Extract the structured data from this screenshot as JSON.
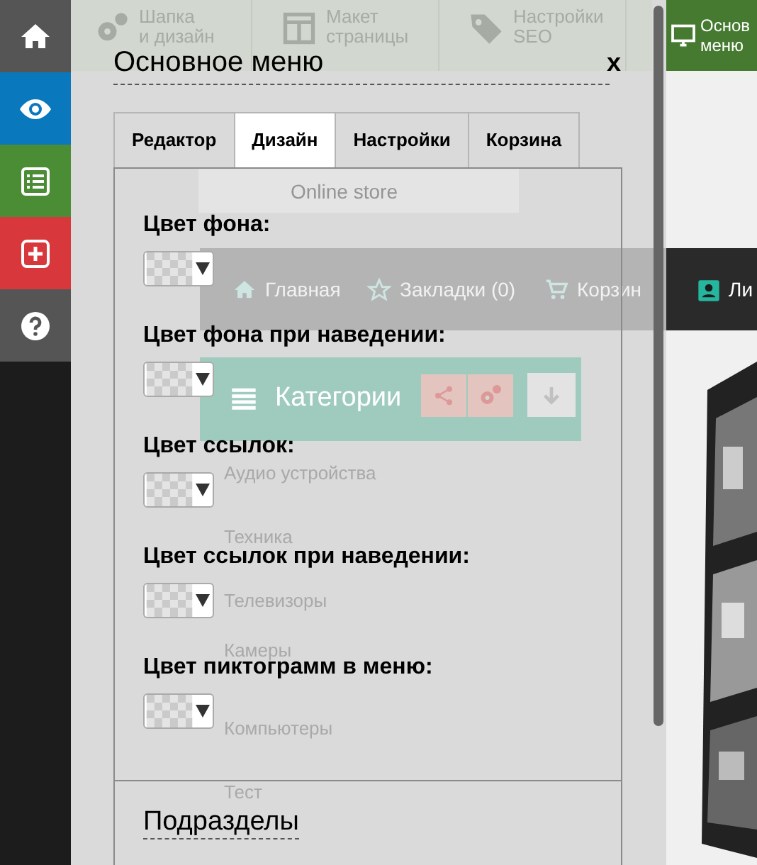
{
  "sidebar": [
    {
      "kind": "home",
      "color": "#555555"
    },
    {
      "kind": "eye",
      "color": "#0a78bd"
    },
    {
      "kind": "list",
      "color": "#4b8d35"
    },
    {
      "kind": "plus",
      "color": "#d8383b"
    },
    {
      "kind": "help",
      "color": "#555555"
    }
  ],
  "background_page": {
    "toolbar": [
      {
        "kind": "gears",
        "label": "Шапка\nи дизайн"
      },
      {
        "kind": "layout",
        "label": "Макет\nстраницы"
      },
      {
        "kind": "tag",
        "label": "Настройки\nSEO"
      }
    ],
    "main_menu_button": "Основ\nменю",
    "logo_tagline": "Online store",
    "nav": [
      {
        "kind": "home",
        "label": "Главная"
      },
      {
        "kind": "star",
        "label": "Закладки (0)"
      },
      {
        "kind": "cart",
        "label": "Корзин"
      }
    ],
    "account_label": "Ли",
    "categories": {
      "title": "Категории",
      "items": [
        "Аудио устройства",
        "Техника",
        "Телевизоры",
        "Камеры",
        "Компьютеры",
        "Тест"
      ]
    }
  },
  "panel": {
    "title": "Основное меню",
    "close": "x",
    "tabs": [
      {
        "label": "Редактор",
        "selected": false
      },
      {
        "label": "Дизайн",
        "selected": true
      },
      {
        "label": "Настройки",
        "selected": false
      },
      {
        "label": "Корзина",
        "selected": false
      }
    ],
    "fields": [
      {
        "label": "Цвет фона:"
      },
      {
        "label": "Цвет фона при наведении:"
      },
      {
        "label": "Цвет ссылок:"
      },
      {
        "label": "Цвет ссылок при наведении:"
      },
      {
        "label": "Цвет пиктограмм в меню:"
      }
    ],
    "section": "Подразделы"
  }
}
